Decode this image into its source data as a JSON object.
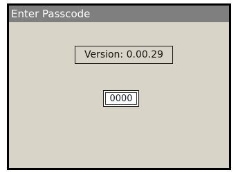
{
  "window": {
    "title": "Enter Passcode"
  },
  "main": {
    "version_text": "Version: 0.00.29",
    "passcode_value": "0000"
  },
  "colors": {
    "title_bar": "#7f7f7f",
    "screen_background": "#d8d4c8",
    "frame": "#000000"
  }
}
